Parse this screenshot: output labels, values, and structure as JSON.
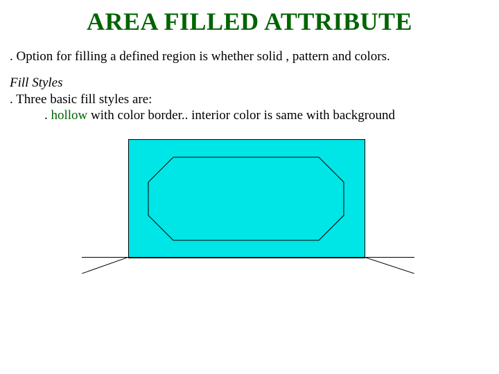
{
  "title": "AREA FILLED ATTRIBUTE",
  "intro": ". Option for filling a defined region is whether solid , pattern and colors.",
  "section_heading": "Fill Styles",
  "line1": ". Three basic fill styles are:",
  "bullet_prefix": ". ",
  "bullet_green": "hollow ",
  "bullet_rest": "with color border.. interior color is same with background",
  "colors": {
    "title": "#006400",
    "rect_fill": "#00e5e5",
    "stroke": "#000000"
  }
}
